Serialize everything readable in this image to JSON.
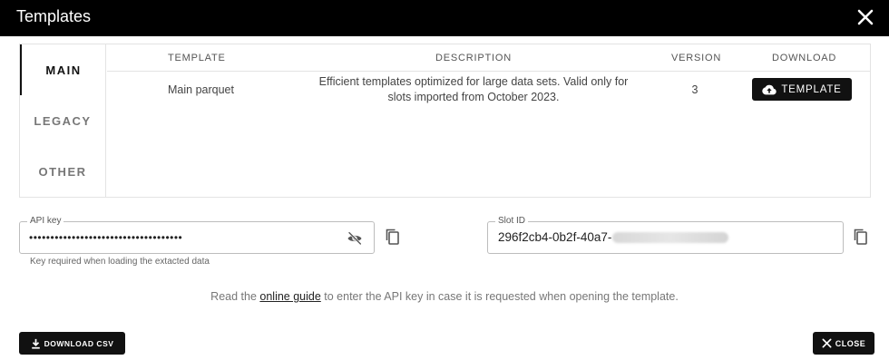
{
  "dialog": {
    "title": "Templates"
  },
  "tabs": [
    {
      "label": "MAIN",
      "active": true
    },
    {
      "label": "LEGACY",
      "active": false
    },
    {
      "label": "OTHER",
      "active": false
    }
  ],
  "table": {
    "headers": {
      "template": "TEMPLATE",
      "description": "DESCRIPTION",
      "version": "VERSION",
      "download": "DOWNLOAD"
    },
    "rows": [
      {
        "template": "Main parquet",
        "description": "Efficient templates optimized for large data sets. Valid only for slots imported from October 2023.",
        "version": "3",
        "download_label": "TEMPLATE"
      }
    ]
  },
  "api_key": {
    "label": "API key",
    "value": "••••••••••••••••••••••••••••••••••••",
    "helper": "Key required when loading the extacted data"
  },
  "slot_id": {
    "label": "Slot ID",
    "value_visible": "296f2cb4-0b2f-40a7-"
  },
  "guide": {
    "before": "Read the ",
    "link": "online guide",
    "after": " to enter the API key in case it is requested when opening the template."
  },
  "footer": {
    "download_csv_label": "DOWNLOAD CSV",
    "close_label": "CLOSE"
  },
  "colors": {
    "titlebar": "#000000",
    "button": "#111111",
    "border": "#e3e3e3"
  },
  "icons": [
    "close-icon",
    "cloud-upload-icon",
    "eye-off-icon",
    "copy-icon",
    "download-icon"
  ]
}
